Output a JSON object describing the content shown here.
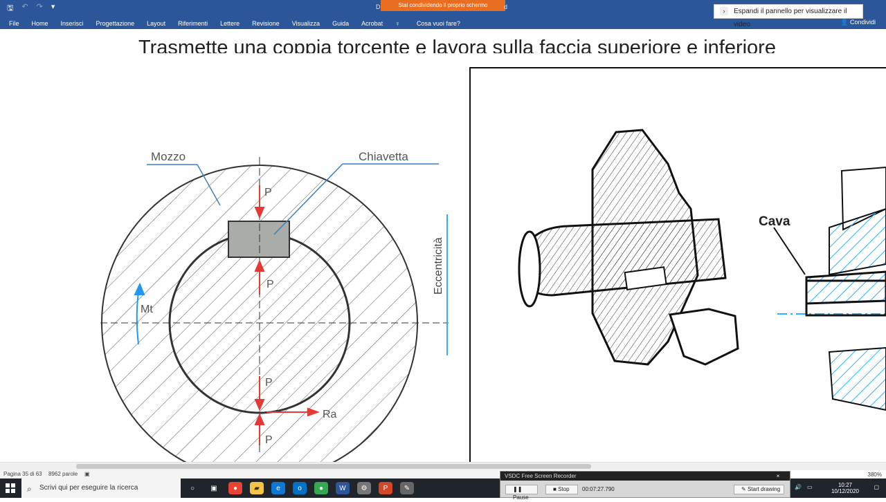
{
  "word": {
    "qat": {
      "save": "🖫",
      "undo": "↶",
      "redo": "↷",
      "more": "▾"
    },
    "title_left": "D...",
    "title_right": "d",
    "share_banner": "Stai condividendo il proprio schermo",
    "menu": [
      "File",
      "Home",
      "Inserisci",
      "Progettazione",
      "Layout",
      "Riferimenti",
      "Lettere",
      "Revisione",
      "Visualizza",
      "Guida",
      "Acrobat"
    ],
    "tell_me": "Cosa vuoi fare?",
    "share": "Condividi",
    "notification": "Espandi il pannello per visualizzare il video"
  },
  "document": {
    "heading": "Trasmette una coppia torcente e lavora sulla faccia superiore e inferiore",
    "labels": {
      "hub": "Mozzo",
      "key": "Chiavetta",
      "eccentricity": "Eccentricità",
      "torque": "Mt",
      "force_top": "P",
      "force_mid": "P",
      "force_low": "P",
      "force_bottom": "P",
      "reaction": "Ra",
      "groove": "Cava"
    }
  },
  "status": {
    "page": "Pagina 35 di 63",
    "words": "8962 parole",
    "zoom": "380%"
  },
  "taskbar": {
    "search": "Scrivi qui per eseguire la ricerca",
    "recorder_title": "VSDC Free Screen Recorder",
    "pause": "Pause",
    "stop": "Stop",
    "timer": "00:07:27.790",
    "draw": "Start drawing",
    "time": "10:27",
    "date": "10/12/2020"
  },
  "colors": {
    "word_blue": "#2b579a",
    "share_orange": "#e86f22",
    "arrow_red": "#e53935",
    "accent_cyan": "#2bb3ff"
  }
}
